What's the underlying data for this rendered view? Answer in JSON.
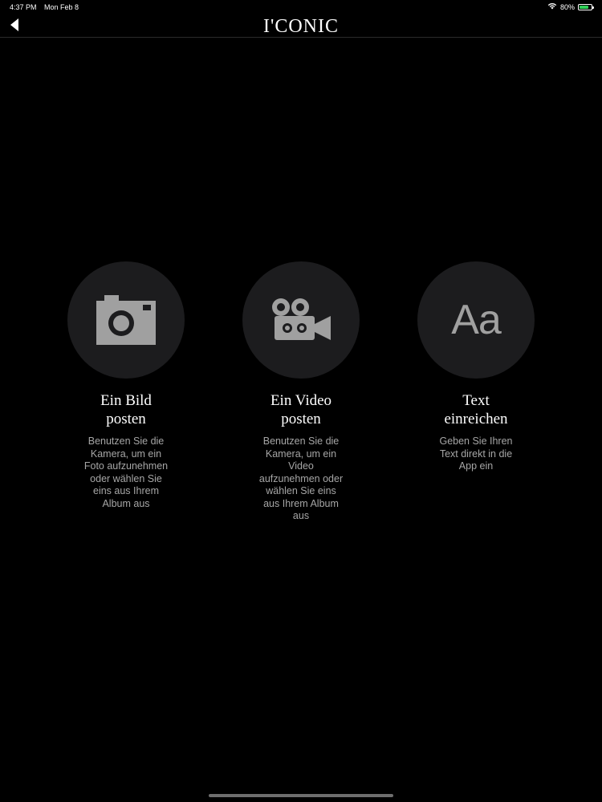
{
  "status_bar": {
    "time": "4:37 PM",
    "date": "Mon Feb 8",
    "battery_percent": "80%",
    "battery_level": 0.8
  },
  "nav": {
    "title": "I'CONIC"
  },
  "options": [
    {
      "title": "Ein Bild\nposten",
      "description": "Benutzen Sie die Kamera, um ein Foto aufzunehmen oder wählen Sie eins aus Ihrem Album aus",
      "icon": "camera-icon"
    },
    {
      "title": "Ein Video\nposten",
      "description": "Benutzen Sie die Kamera, um ein Video aufzunehmen oder wählen Sie eins aus Ihrem Album aus",
      "icon": "video-camera-icon"
    },
    {
      "title": "Text\neinreichen",
      "description": "Geben Sie Ihren Text direkt in die App ein",
      "icon": "text-icon",
      "glyph": "Aa"
    }
  ],
  "colors": {
    "background": "#000000",
    "circle": "#1c1c1e",
    "icon": "#a0a0a0",
    "description": "#a6a6a6",
    "battery": "#30d158"
  }
}
